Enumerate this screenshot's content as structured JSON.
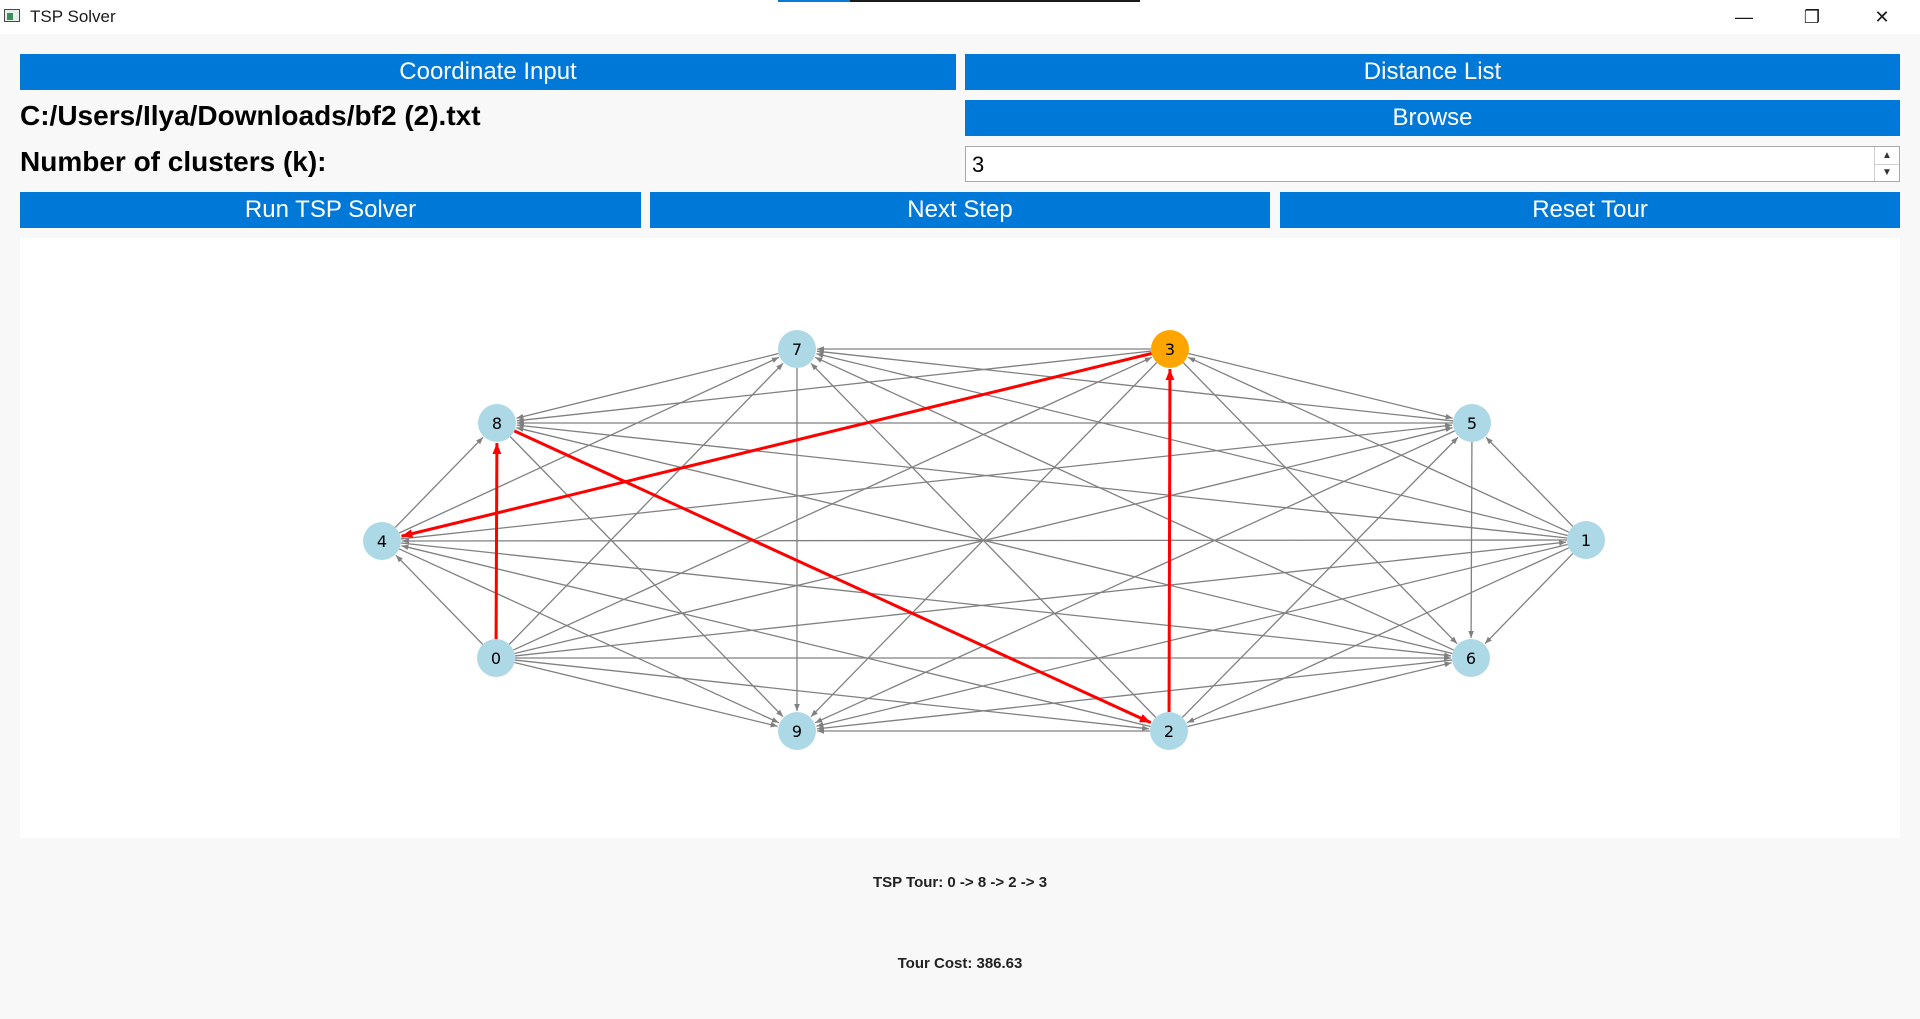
{
  "window": {
    "title": "TSP Solver",
    "minimize_glyph": "—",
    "restore_glyph": "❐",
    "close_glyph": "✕"
  },
  "buttons": {
    "coordinate_input": "Coordinate Input",
    "distance_list": "Distance List",
    "browse": "Browse",
    "run_solver": "Run TSP Solver",
    "next_step": "Next Step",
    "reset_tour": "Reset Tour"
  },
  "file_path": "C:/Users/Ilya/Downloads/bf2 (2).txt",
  "clusters": {
    "label": "Number of clusters (k):",
    "value": "3"
  },
  "graph": {
    "nodes": [
      {
        "id": "0",
        "color": "#add8e6"
      },
      {
        "id": "1",
        "color": "#add8e6"
      },
      {
        "id": "2",
        "color": "#add8e6"
      },
      {
        "id": "3",
        "color": "#ffa500"
      },
      {
        "id": "4",
        "color": "#add8e6"
      },
      {
        "id": "5",
        "color": "#add8e6"
      },
      {
        "id": "6",
        "color": "#add8e6"
      },
      {
        "id": "7",
        "color": "#add8e6"
      },
      {
        "id": "8",
        "color": "#add8e6"
      },
      {
        "id": "9",
        "color": "#add8e6"
      }
    ],
    "tour_edges": [
      [
        "0",
        "8"
      ],
      [
        "8",
        "2"
      ],
      [
        "2",
        "3"
      ],
      [
        "3",
        "4"
      ]
    ],
    "edge_color": "#808080",
    "tour_color": "#ff0000"
  },
  "results": {
    "tour": "TSP Tour: 0 -> 8 -> 2 -> 3",
    "cost": "Tour Cost: 386.63"
  }
}
